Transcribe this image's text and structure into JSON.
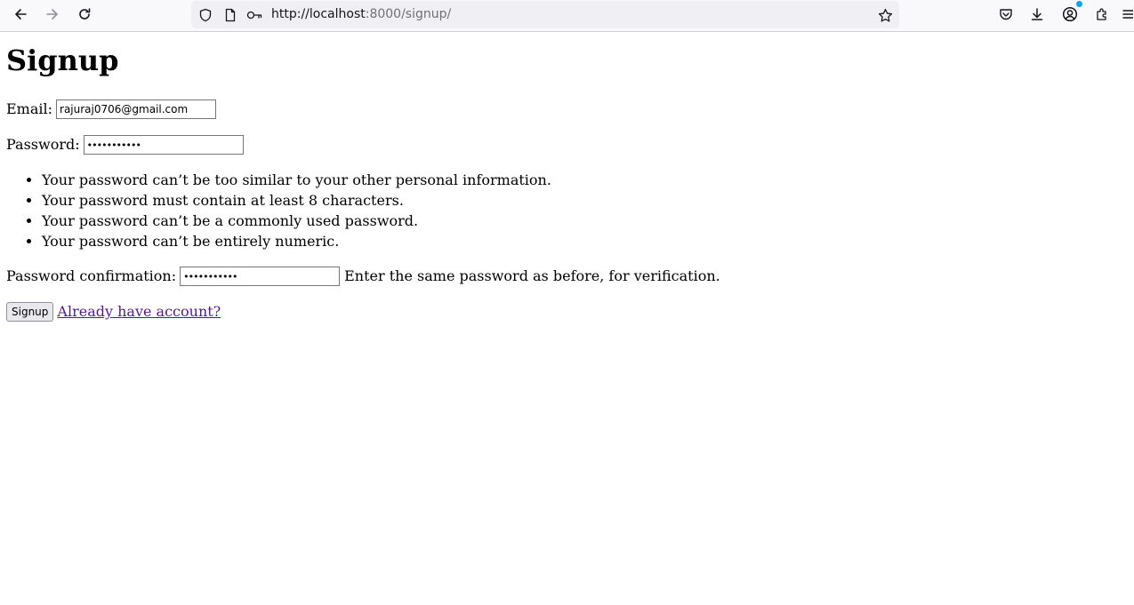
{
  "browser": {
    "url_host": "http://localhost",
    "url_rest": ":8000/signup/",
    "icons": [
      "back-arrow-icon",
      "forward-arrow-icon",
      "reload-icon",
      "shield-icon",
      "page-icon",
      "key-icon",
      "bookmark-star-icon",
      "pocket-icon",
      "download-icon",
      "account-icon",
      "extensions-icon",
      "menu-icon"
    ]
  },
  "page": {
    "title": "Signup",
    "email_label": "Email:",
    "email_value": "rajuraj0706@gmail.com",
    "password_label": "Password:",
    "password_value": "•••••••••••",
    "password_help": [
      "Your password can’t be too similar to your other personal information.",
      "Your password must contain at least 8 characters.",
      "Your password can’t be a commonly used password.",
      "Your password can’t be entirely numeric."
    ],
    "confirm_label": "Password confirmation:",
    "confirm_value": "•••••••••••",
    "confirm_help": "Enter the same password as before, for verification.",
    "submit_label": "Signup",
    "login_link": "Already have account?"
  },
  "colors": {
    "visited_link": "#551a8b",
    "toolbar_bg": "#f9f9fb",
    "urlbar_bg": "#f0f0f4",
    "notification_dot": "#0ea4e9"
  }
}
